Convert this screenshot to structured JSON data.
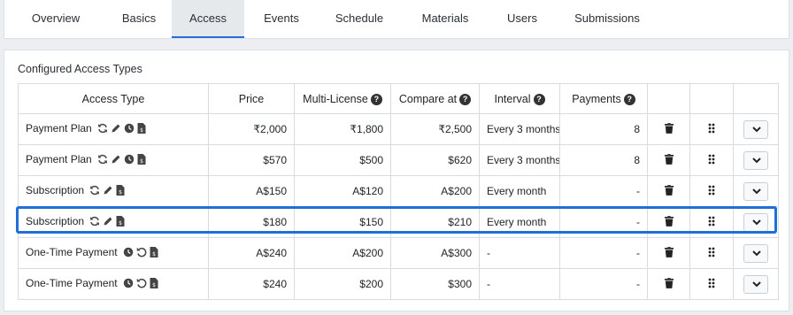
{
  "tabs": [
    {
      "label": "Overview",
      "active": false
    },
    {
      "label": "Basics",
      "active": false
    },
    {
      "label": "Access",
      "active": true
    },
    {
      "label": "Events",
      "active": false
    },
    {
      "label": "Schedule",
      "active": false
    },
    {
      "label": "Materials",
      "active": false
    },
    {
      "label": "Users",
      "active": false
    },
    {
      "label": "Submissions",
      "active": false
    }
  ],
  "card": {
    "title": "Configured Access Types"
  },
  "table": {
    "headers": [
      "Access Type",
      "Price",
      "Multi-License",
      "Compare at",
      "Interval",
      "Payments"
    ],
    "help_glyph": "?",
    "rows": [
      {
        "type": "Payment Plan",
        "price": "₹2,000",
        "multi": "₹1,800",
        "compare": "₹2,500",
        "interval": "Every 3 months",
        "payments": "8",
        "icons": [
          "sync-icon",
          "pencil-icon",
          "clock-icon",
          "file-dollar-icon"
        ]
      },
      {
        "type": "Payment Plan",
        "price": "$570",
        "multi": "$500",
        "compare": "$620",
        "interval": "Every 3 months",
        "payments": "8",
        "icons": [
          "sync-icon",
          "pencil-icon",
          "clock-icon",
          "file-dollar-icon"
        ]
      },
      {
        "type": "Subscription",
        "price": "A$150",
        "multi": "A$120",
        "compare": "A$200",
        "interval": "Every month",
        "payments": "-",
        "icons": [
          "sync-icon",
          "pencil-icon",
          "file-dollar-icon"
        ]
      },
      {
        "type": "Subscription",
        "price": "$180",
        "multi": "$150",
        "compare": "$210",
        "interval": "Every month",
        "payments": "-",
        "icons": [
          "sync-icon",
          "pencil-icon",
          "file-dollar-icon"
        ]
      },
      {
        "type": "One-Time Payment",
        "price": "A$240",
        "multi": "A$200",
        "compare": "A$300",
        "interval": "-",
        "payments": "-",
        "icons": [
          "clock-icon",
          "undo-icon",
          "file-dollar-icon"
        ]
      },
      {
        "type": "One-Time Payment",
        "price": "$240",
        "multi": "$200",
        "compare": "$300",
        "interval": "-",
        "payments": "-",
        "icons": [
          "clock-icon",
          "undo-icon",
          "file-dollar-icon"
        ]
      }
    ],
    "highlighted_row": 3
  },
  "colors": {
    "accent": "#1f6fd6",
    "active_tab_bg": "#e6e9ec",
    "border": "#d8dce0"
  }
}
